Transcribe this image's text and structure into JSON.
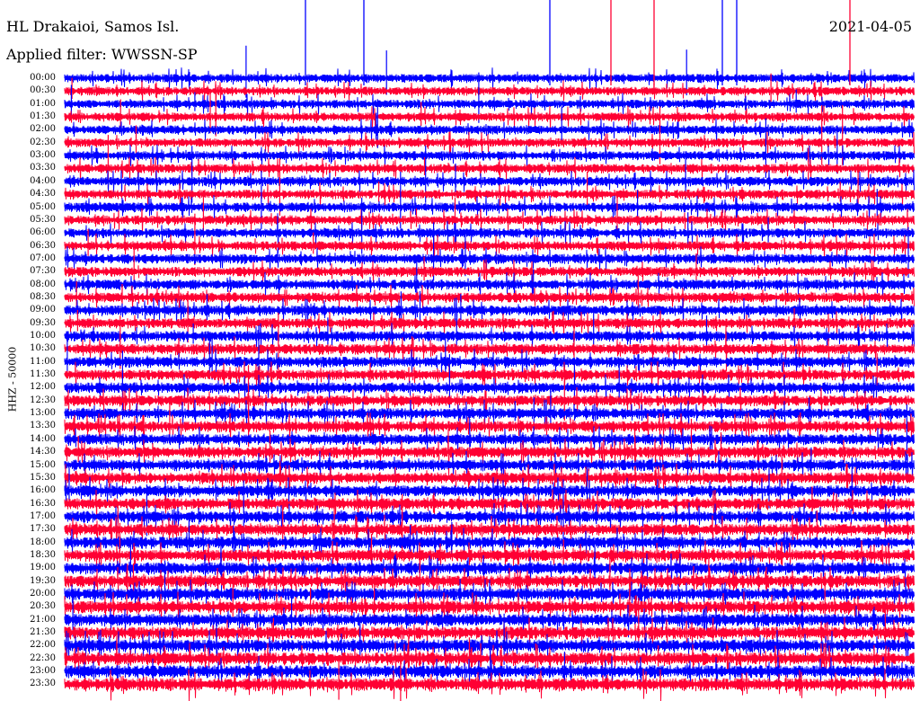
{
  "header": {
    "station": "HL Drakaioi, Samos Isl.",
    "date": "2021-04-05",
    "filter": "Applied filter: WWSSN-SP"
  },
  "chart_data": {
    "type": "line",
    "title": "HL Drakaioi, Samos Isl.",
    "subtitle": "Applied filter: WWSSN-SP",
    "date": "2021-04-05",
    "ylabel": "HHZ - 50000",
    "row_labels": [
      "00:00",
      "00:30",
      "01:00",
      "01:30",
      "02:00",
      "02:30",
      "03:00",
      "03:30",
      "04:00",
      "04:30",
      "05:00",
      "05:30",
      "06:00",
      "06:30",
      "07:00",
      "07:30",
      "08:00",
      "08:30",
      "09:00",
      "09:30",
      "10:00",
      "10:30",
      "11:00",
      "11:30",
      "12:00",
      "12:30",
      "13:00",
      "13:30",
      "14:00",
      "14:30",
      "15:00",
      "15:30",
      "16:00",
      "16:30",
      "17:00",
      "17:30",
      "18:00",
      "18:30",
      "19:00",
      "19:30",
      "20:00",
      "20:30",
      "21:00",
      "21:30",
      "22:00",
      "22:30",
      "23:00",
      "23:30"
    ],
    "trace_colors": [
      "#0000ff",
      "#ff0033"
    ],
    "grid": false
  }
}
